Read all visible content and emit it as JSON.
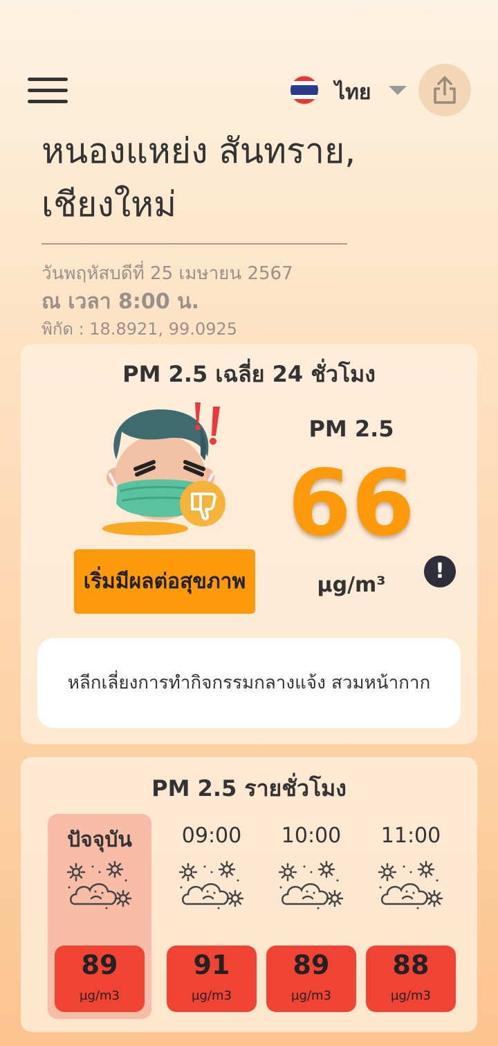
{
  "header": {
    "menu_icon": "hamburger-menu-icon",
    "language": "ไทย",
    "flag_icon": "thai-flag-icon",
    "share_icon": "share-icon"
  },
  "location": {
    "name_line1": "หนองแหย่ง สันทราย,",
    "name_line2": "เชียงใหม่",
    "date": "วันพฤหัสบดีที่ 25 เมษายน 2567",
    "time": "ณ เวลา 8:00 น.",
    "coords": "พิกัด : 18.8921, 99.0925"
  },
  "summary": {
    "title": "PM 2.5 เฉลี่ย 24 ชั่วโมง",
    "pm_label": "PM 2.5",
    "pm_value": "66",
    "pm_unit": "µg/m³",
    "status": "เริ่มมีผลต่อสุขภาพ",
    "status_color": "#fd9a0b",
    "info_symbol": "!",
    "advice": "หลีกเลี่ยงการทำกิจกรรมกลางแจ้ง สวมหน้ากาก"
  },
  "hourly": {
    "title": "PM 2.5 รายชั่วโมง",
    "items": [
      {
        "label": "ปัจจุบัน",
        "value": "89",
        "unit": "µg/m3",
        "icon": "hazy-cloud-icon"
      },
      {
        "label": "09:00",
        "value": "91",
        "unit": "µg/m3",
        "icon": "hazy-cloud-icon"
      },
      {
        "label": "10:00",
        "value": "89",
        "unit": "µg/m3",
        "icon": "hazy-cloud-icon"
      },
      {
        "label": "11:00",
        "value": "88",
        "unit": "µg/m3",
        "icon": "hazy-cloud-icon"
      }
    ],
    "badge_color": "#f04333"
  }
}
